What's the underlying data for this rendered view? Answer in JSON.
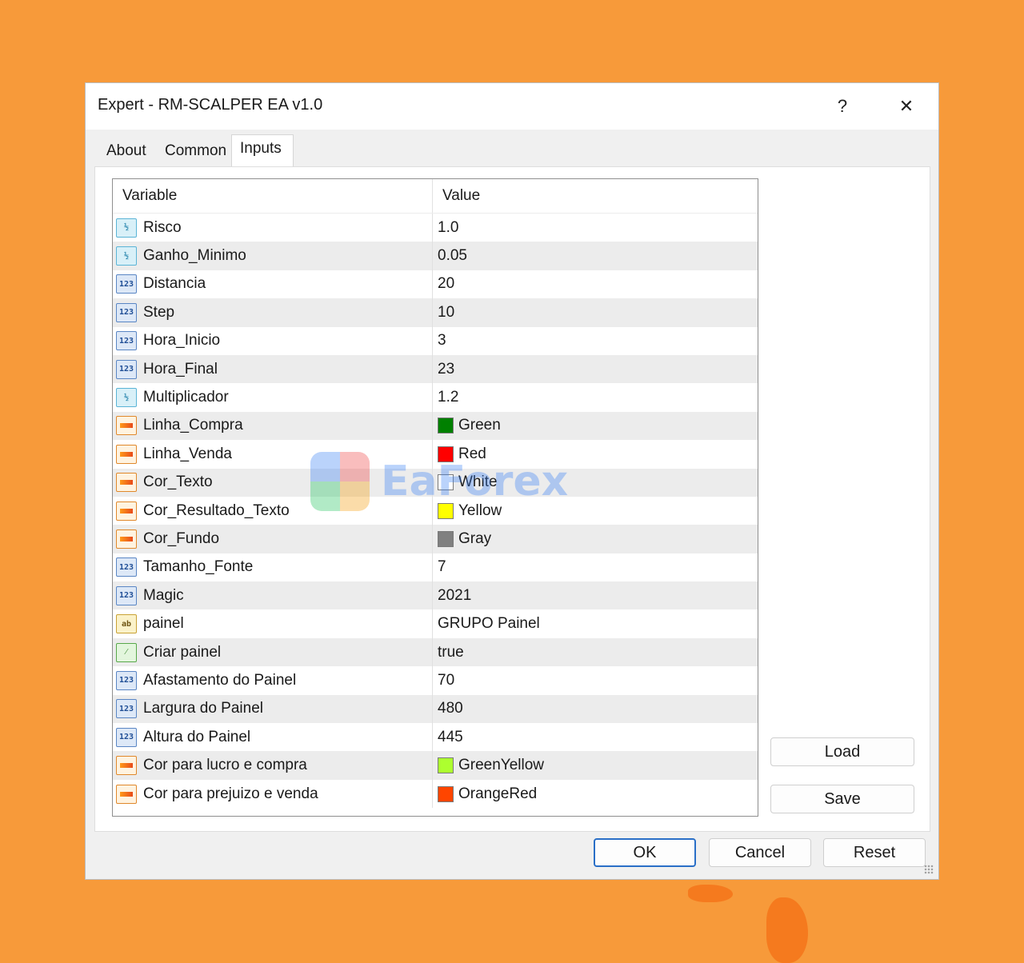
{
  "window": {
    "title": "Expert - RM-SCALPER EA v1.0",
    "help_label": "?",
    "close_label": "✕"
  },
  "tabs": [
    {
      "label": "About"
    },
    {
      "label": "Common"
    },
    {
      "label": "Inputs",
      "active": true
    }
  ],
  "table": {
    "columns": [
      "Variable",
      "Value"
    ],
    "rows": [
      {
        "variable": "Risco",
        "value": "1.0",
        "type": "double"
      },
      {
        "variable": "Ganho_Minimo",
        "value": "0.05",
        "type": "double"
      },
      {
        "variable": "Distancia",
        "value": "20",
        "type": "int"
      },
      {
        "variable": "Step",
        "value": "10",
        "type": "int"
      },
      {
        "variable": "Hora_Inicio",
        "value": "3",
        "type": "int"
      },
      {
        "variable": "Hora_Final",
        "value": "23",
        "type": "int"
      },
      {
        "variable": "Multiplicador",
        "value": "1.2",
        "type": "double"
      },
      {
        "variable": "Linha_Compra",
        "value": "Green",
        "type": "color",
        "color": "#008000"
      },
      {
        "variable": "Linha_Venda",
        "value": "Red",
        "type": "color",
        "color": "#ff0000"
      },
      {
        "variable": "Cor_Texto",
        "value": "White",
        "type": "color",
        "color": "#ffffff"
      },
      {
        "variable": "Cor_Resultado_Texto",
        "value": "Yellow",
        "type": "color",
        "color": "#ffff00"
      },
      {
        "variable": "Cor_Fundo",
        "value": "Gray",
        "type": "color",
        "color": "#808080"
      },
      {
        "variable": "Tamanho_Fonte",
        "value": "7",
        "type": "int"
      },
      {
        "variable": "Magic",
        "value": "2021",
        "type": "int"
      },
      {
        "variable": "painel",
        "value": "GRUPO Painel",
        "type": "string"
      },
      {
        "variable": "Criar painel",
        "value": "true",
        "type": "bool"
      },
      {
        "variable": "Afastamento do Painel",
        "value": "70",
        "type": "int"
      },
      {
        "variable": "Largura do Painel",
        "value": "480",
        "type": "int"
      },
      {
        "variable": "Altura do Painel",
        "value": "445",
        "type": "int"
      },
      {
        "variable": "Cor para lucro e compra",
        "value": "GreenYellow",
        "type": "color",
        "color": "#adff2f"
      },
      {
        "variable": "Cor para prejuizo e venda",
        "value": "OrangeRed",
        "type": "color",
        "color": "#ff4500"
      }
    ]
  },
  "icons": {
    "double": {
      "glyph": "½"
    },
    "int": {
      "glyph": "123"
    },
    "string": {
      "glyph": "ab"
    },
    "bool": {
      "glyph": "⁄"
    },
    "color": {
      "glyph": ""
    }
  },
  "buttons": {
    "load": "Load",
    "save": "Save",
    "ok": "OK",
    "cancel": "Cancel",
    "reset": "Reset"
  },
  "watermark": {
    "text": "EaForex"
  },
  "colors": {
    "background": "#f79a3a",
    "accent": "#2a6fc7"
  }
}
